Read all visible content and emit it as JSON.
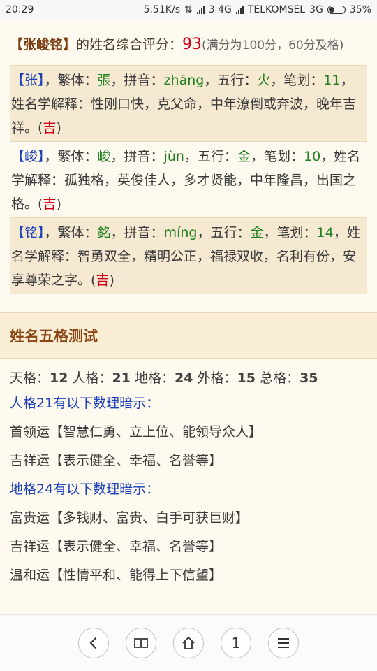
{
  "status_bar": {
    "time": "20:29",
    "net_speed": "5.51K/s",
    "sim_label": "3 4G",
    "carrier": "TELKOMSEL",
    "network": "3G",
    "battery_text": "35%",
    "battery_level": 0.35
  },
  "summary": {
    "name": "【张峻铭】",
    "text": "的姓名综合评分：",
    "score": "93",
    "note": "(满分为100分，60分及格)"
  },
  "chars": [
    {
      "char": "【张】",
      "sep1": "，繁体：",
      "trad": "張",
      "sep2": "，拼音：",
      "pinyin": "zhāng",
      "sep3": "，五行：",
      "element": "火",
      "sep4": "，笔划：",
      "strokes": "11",
      "sep5": "，姓名学解释：性刚口快，克父命，中年潦倒或奔波，晚年吉祥。(",
      "luck": "吉",
      "tail": ")"
    },
    {
      "char": "【峻】",
      "sep1": "，繁体：",
      "trad": "峻",
      "sep2": "，拼音：",
      "pinyin": "jùn",
      "sep3": "，五行：",
      "element": "金",
      "sep4": "，笔划：",
      "strokes": "10",
      "sep5": "，姓名学解释：孤独格，英俊佳人，多才贤能，中年隆昌，出国之格。(",
      "luck": "吉",
      "tail": ")"
    },
    {
      "char": "【铭】",
      "sep1": "，繁体：",
      "trad": "銘",
      "sep2": "，拼音：",
      "pinyin": "míng",
      "sep3": "，五行：",
      "element": "金",
      "sep4": "，笔划：",
      "strokes": "14",
      "sep5": "，姓名学解释：智勇双全，精明公正，福禄双收，名利有份，安享尊荣之字。(",
      "luck": "吉",
      "tail": ")"
    }
  ],
  "section": {
    "title": "姓名五格测试"
  },
  "wuge": {
    "tian_label": "天格：",
    "tian": "12",
    "ren_label": "人格：",
    "ren": "21",
    "di_label": "地格：",
    "di": "24",
    "wai_label": "外格：",
    "wai": "15",
    "zong_label": "总格：",
    "zong": "35"
  },
  "hints": [
    {
      "text": "人格21有以下数理暗示：",
      "style": "blue"
    },
    {
      "text": "首领运【智慧仁勇、立上位、能领导众人】",
      "style": "plain"
    },
    {
      "text": "吉祥运【表示健全、幸福、名誉等】",
      "style": "plain"
    },
    {
      "text": "地格24有以下数理暗示：",
      "style": "blue"
    },
    {
      "text": "富贵运【多钱财、富贵、白手可获巨财】",
      "style": "plain"
    },
    {
      "text": "吉祥运【表示健全、幸福、名誉等】",
      "style": "plain"
    },
    {
      "text": "温和运【性情平和、能得上下信望】",
      "style": "plain"
    }
  ],
  "bottom_nav": {
    "back_icon": "chevron-left",
    "book_icon": "open-book",
    "home_icon": "home",
    "tab_count": "1",
    "menu_icon": "hamburger"
  }
}
